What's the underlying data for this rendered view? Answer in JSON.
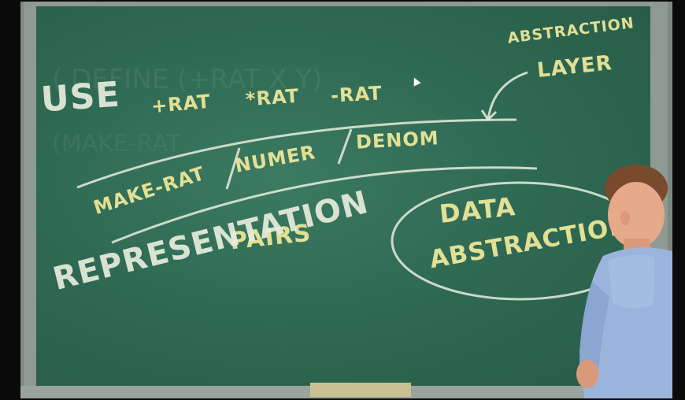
{
  "board": {
    "use": "USE",
    "add_rat": "+RAT",
    "mul_rat": "*RAT",
    "sub_rat": "-RAT",
    "abstraction": "ABSTRACTION",
    "layer": "LAYER",
    "make_rat": "MAKE-RAT",
    "numer": "NUMER",
    "denom": "DENOM",
    "pairs": "PAIRS",
    "representation": "REPRESENTATION",
    "data": "DATA",
    "abstraction2": "ABSTRACTION"
  },
  "icons": [
    "cursor-icon"
  ],
  "colors": {
    "board": "#2f6a54",
    "chalk": "#e8eddc",
    "chalk_yellow": "#f1ea9a",
    "shirt": "#9bb4dc"
  }
}
